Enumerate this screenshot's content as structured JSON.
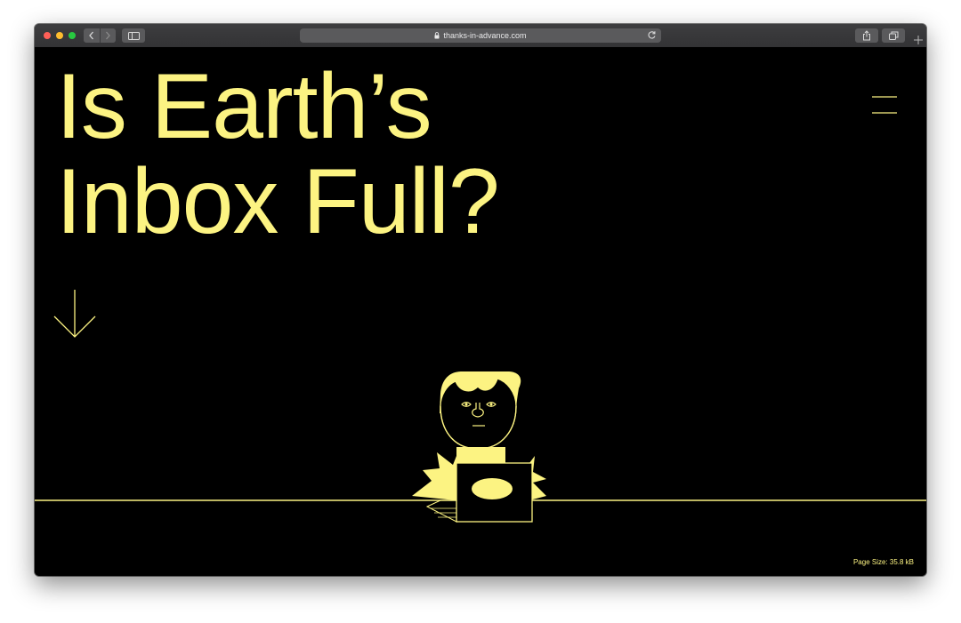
{
  "browser": {
    "url": "thanks-in-advance.com"
  },
  "hero": {
    "headline_line1": "Is Earth’s",
    "headline_line2": "Inbox Full?"
  },
  "footer": {
    "page_size": "Page Size: 35.8 kB"
  },
  "colors": {
    "background": "#000000",
    "accent": "#fcf382",
    "toolbar": "#3a3a3c"
  },
  "icons": [
    "back-icon",
    "forward-icon",
    "sidebar-icon",
    "lock-icon",
    "reload-icon",
    "share-icon",
    "tabs-icon",
    "new-tab-icon",
    "hamburger-menu-icon",
    "down-arrow-icon"
  ]
}
